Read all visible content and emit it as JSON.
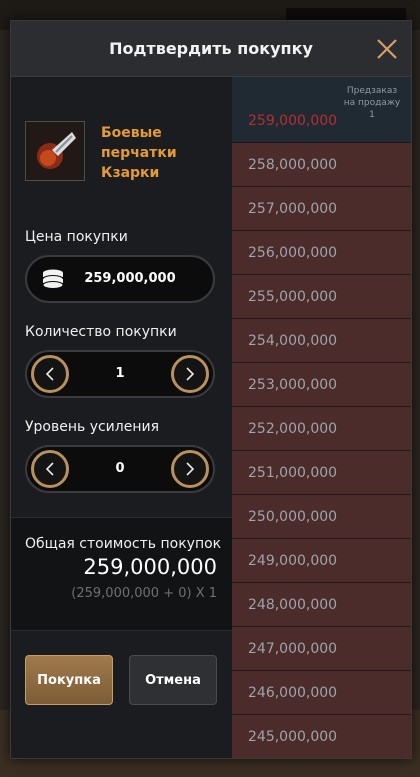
{
  "dialog": {
    "title": "Подтвердить покупку"
  },
  "item": {
    "name": "Боевые перчатки Кзарки"
  },
  "price": {
    "label": "Цена покупки",
    "value": "259,000,000"
  },
  "quantity": {
    "label": "Количество покупки",
    "value": "1"
  },
  "enhancement": {
    "label": "Уровень усиления",
    "value": "0"
  },
  "total": {
    "label": "Общая стоимость покупок",
    "value": "259,000,000",
    "formula": "(259,000,000 + 0) X 1"
  },
  "buttons": {
    "buy": "Покупка",
    "cancel": "Отмена"
  },
  "market": {
    "preorder_label": "Предзаказ на продажу",
    "preorder_count": "1",
    "current": "259,000,000",
    "prices": [
      "258,000,000",
      "257,000,000",
      "256,000,000",
      "255,000,000",
      "254,000,000",
      "253,000,000",
      "252,000,000",
      "251,000,000",
      "250,000,000",
      "249,000,000",
      "248,000,000",
      "247,000,000",
      "246,000,000",
      "245,000,000"
    ]
  },
  "colors": {
    "accent": "#e49b33",
    "gold_ring": "#b8915e",
    "sell_row": "#4c2b2b",
    "current_price": "#b92d2d"
  }
}
